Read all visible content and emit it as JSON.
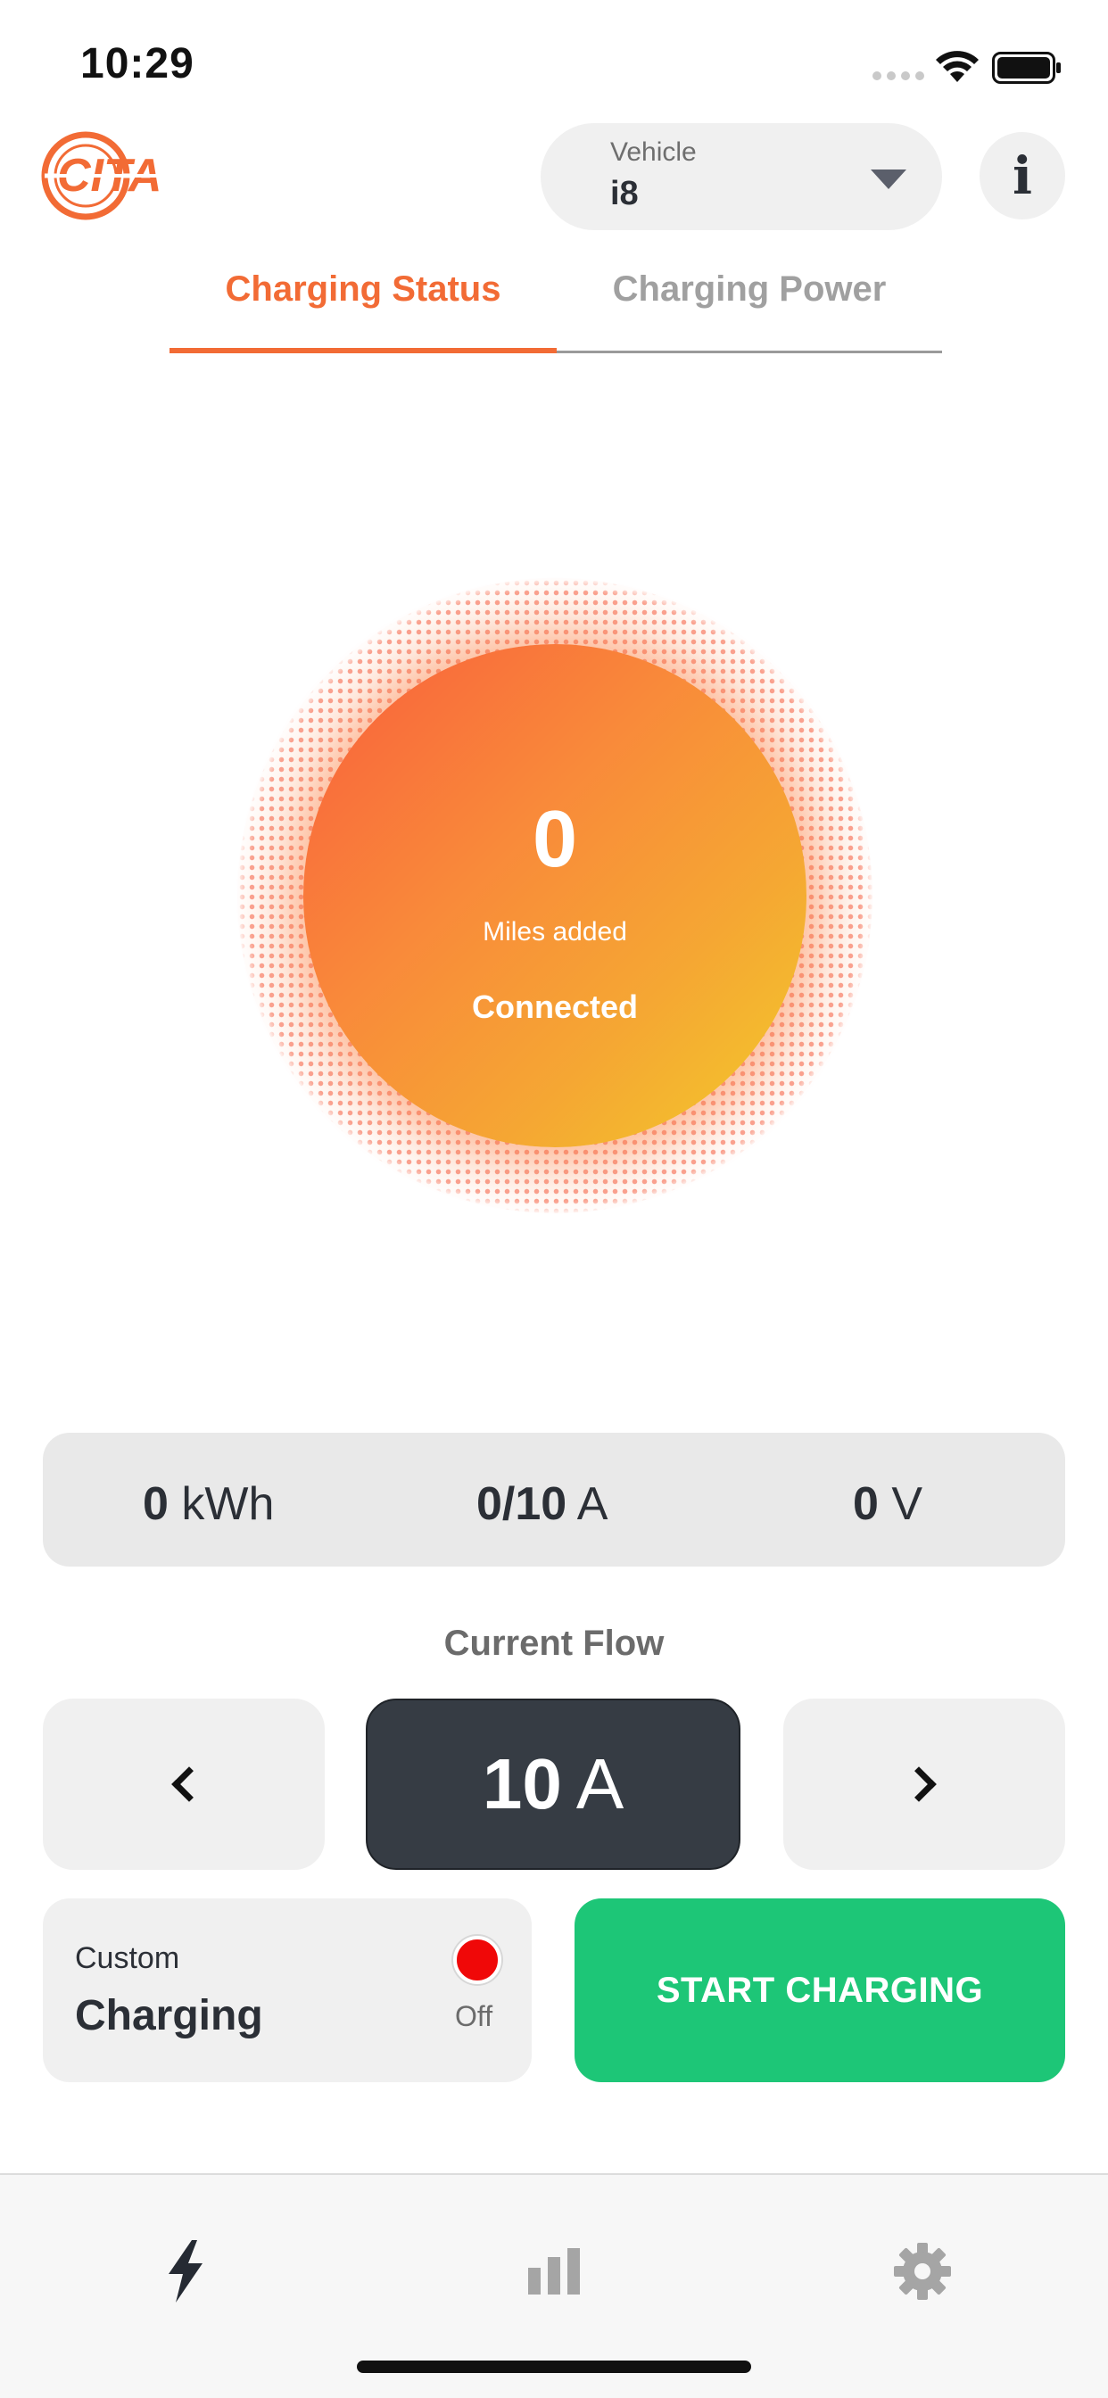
{
  "status_bar": {
    "time": "10:29",
    "icons": [
      "cellular-signal-icon",
      "wifi-icon",
      "battery-icon"
    ]
  },
  "header": {
    "logo_text": "CITA",
    "vehicle_label": "Vehicle",
    "vehicle_value": "i8",
    "info_label": "i"
  },
  "tabs": [
    {
      "label": "Charging Status",
      "active": true
    },
    {
      "label": "Charging Power",
      "active": false
    }
  ],
  "charge_orb": {
    "value": "0",
    "label": "Miles added",
    "status": "Connected"
  },
  "metrics": {
    "energy_value": "0",
    "energy_unit": "kWh",
    "current_value": "0/10",
    "current_unit": "A",
    "voltage_value": "0",
    "voltage_unit": "V"
  },
  "current_flow": {
    "title": "Current Flow",
    "value": "10",
    "unit": "A"
  },
  "custom_charging": {
    "label": "Custom",
    "title": "Charging",
    "toggle_state": "Off"
  },
  "start_button": {
    "label": "START CHARGING"
  },
  "bottom_nav": [
    {
      "icon": "lightning-icon",
      "active": true
    },
    {
      "icon": "bar-chart-icon",
      "active": false
    },
    {
      "icon": "gear-icon",
      "active": false
    }
  ],
  "colors": {
    "accent": "#f26b35",
    "start_green": "#1dc677",
    "toggle_red": "#f00808",
    "flow_dark": "#363c44"
  }
}
